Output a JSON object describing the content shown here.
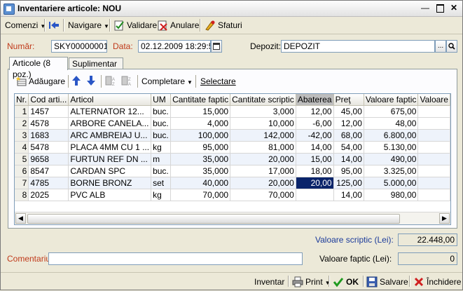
{
  "window": {
    "title": "Inventariere articole: NOU"
  },
  "toolbar": {
    "comenzi": "Comenzi",
    "navigare": "Navigare",
    "validare": "Validare",
    "anulare": "Anulare",
    "sfaturi": "Sfaturi"
  },
  "header": {
    "numar_label": "Număr:",
    "numar_value": "SKY00000001",
    "data_label": "Data:",
    "data_value": "02.12.2009 18:29:58",
    "depozit_label": "Depozit:",
    "depozit_value": "DEPOZIT"
  },
  "tabs": [
    {
      "label": "Articole (8 poz.)"
    },
    {
      "label": "Suplimentar"
    }
  ],
  "panel_toolbar": {
    "adaugare": "Adăugare",
    "completare": "Completare",
    "selectare": "Selectare"
  },
  "grid": {
    "columns": [
      "Nr.",
      "Cod arti...",
      "Articol",
      "UM",
      "Cantitate faptic",
      "Cantitate scriptic",
      "Abaterea",
      "Preţ",
      "Valoare faptic",
      "Valoare"
    ],
    "rows": [
      {
        "nr": "1",
        "cod": "1457",
        "articol": "ALTERNATOR 12...",
        "um": "buc.",
        "faptic": "15,000",
        "scriptic": "3,000",
        "abaterea": "12,00",
        "pret": "45,00",
        "valoare": "675,00"
      },
      {
        "nr": "2",
        "cod": "4578",
        "articol": "ARBORE CANELA...",
        "um": "buc.",
        "faptic": "4,000",
        "scriptic": "10,000",
        "abaterea": "-6,00",
        "pret": "12,00",
        "valoare": "48,00"
      },
      {
        "nr": "3",
        "cod": "1683",
        "articol": "ARC AMBREIAJ U...",
        "um": "buc.",
        "faptic": "100,000",
        "scriptic": "142,000",
        "abaterea": "-42,00",
        "pret": "68,00",
        "valoare": "6.800,00"
      },
      {
        "nr": "4",
        "cod": "5478",
        "articol": "PLACA 4MM CU 1 ...",
        "um": "kg",
        "faptic": "95,000",
        "scriptic": "81,000",
        "abaterea": "14,00",
        "pret": "54,00",
        "valoare": "5.130,00"
      },
      {
        "nr": "5",
        "cod": "9658",
        "articol": "FURTUN REF DN ...",
        "um": "m",
        "faptic": "35,000",
        "scriptic": "20,000",
        "abaterea": "15,00",
        "pret": "14,00",
        "valoare": "490,00"
      },
      {
        "nr": "6",
        "cod": "8547",
        "articol": "CARDAN SPC",
        "um": "buc.",
        "faptic": "35,000",
        "scriptic": "17,000",
        "abaterea": "18,00",
        "pret": "95,00",
        "valoare": "3.325,00"
      },
      {
        "nr": "7",
        "cod": "4785",
        "articol": "BORNE BRONZ",
        "um": "set",
        "faptic": "40,000",
        "scriptic": "20,000",
        "abaterea": "20,00",
        "pret": "125,00",
        "valoare": "5.000,00"
      },
      {
        "nr": "8",
        "cod": "2025",
        "articol": "PVC ALB",
        "um": "kg",
        "faptic": "70,000",
        "scriptic": "70,000",
        "abaterea": "",
        "pret": "14,00",
        "valoare": "980,00"
      }
    ]
  },
  "totals": {
    "scriptic_label": "Valoare scriptic (Lei):",
    "scriptic_value": "22.448,00",
    "faptic_label": "Valoare faptic (Lei):",
    "faptic_value": "0"
  },
  "comentariu_label": "Comentariu:",
  "bottom": {
    "inventar": "Inventar",
    "print": "Print",
    "ok": "OK",
    "salvare": "Salvare",
    "inchidere": "Închidere"
  }
}
